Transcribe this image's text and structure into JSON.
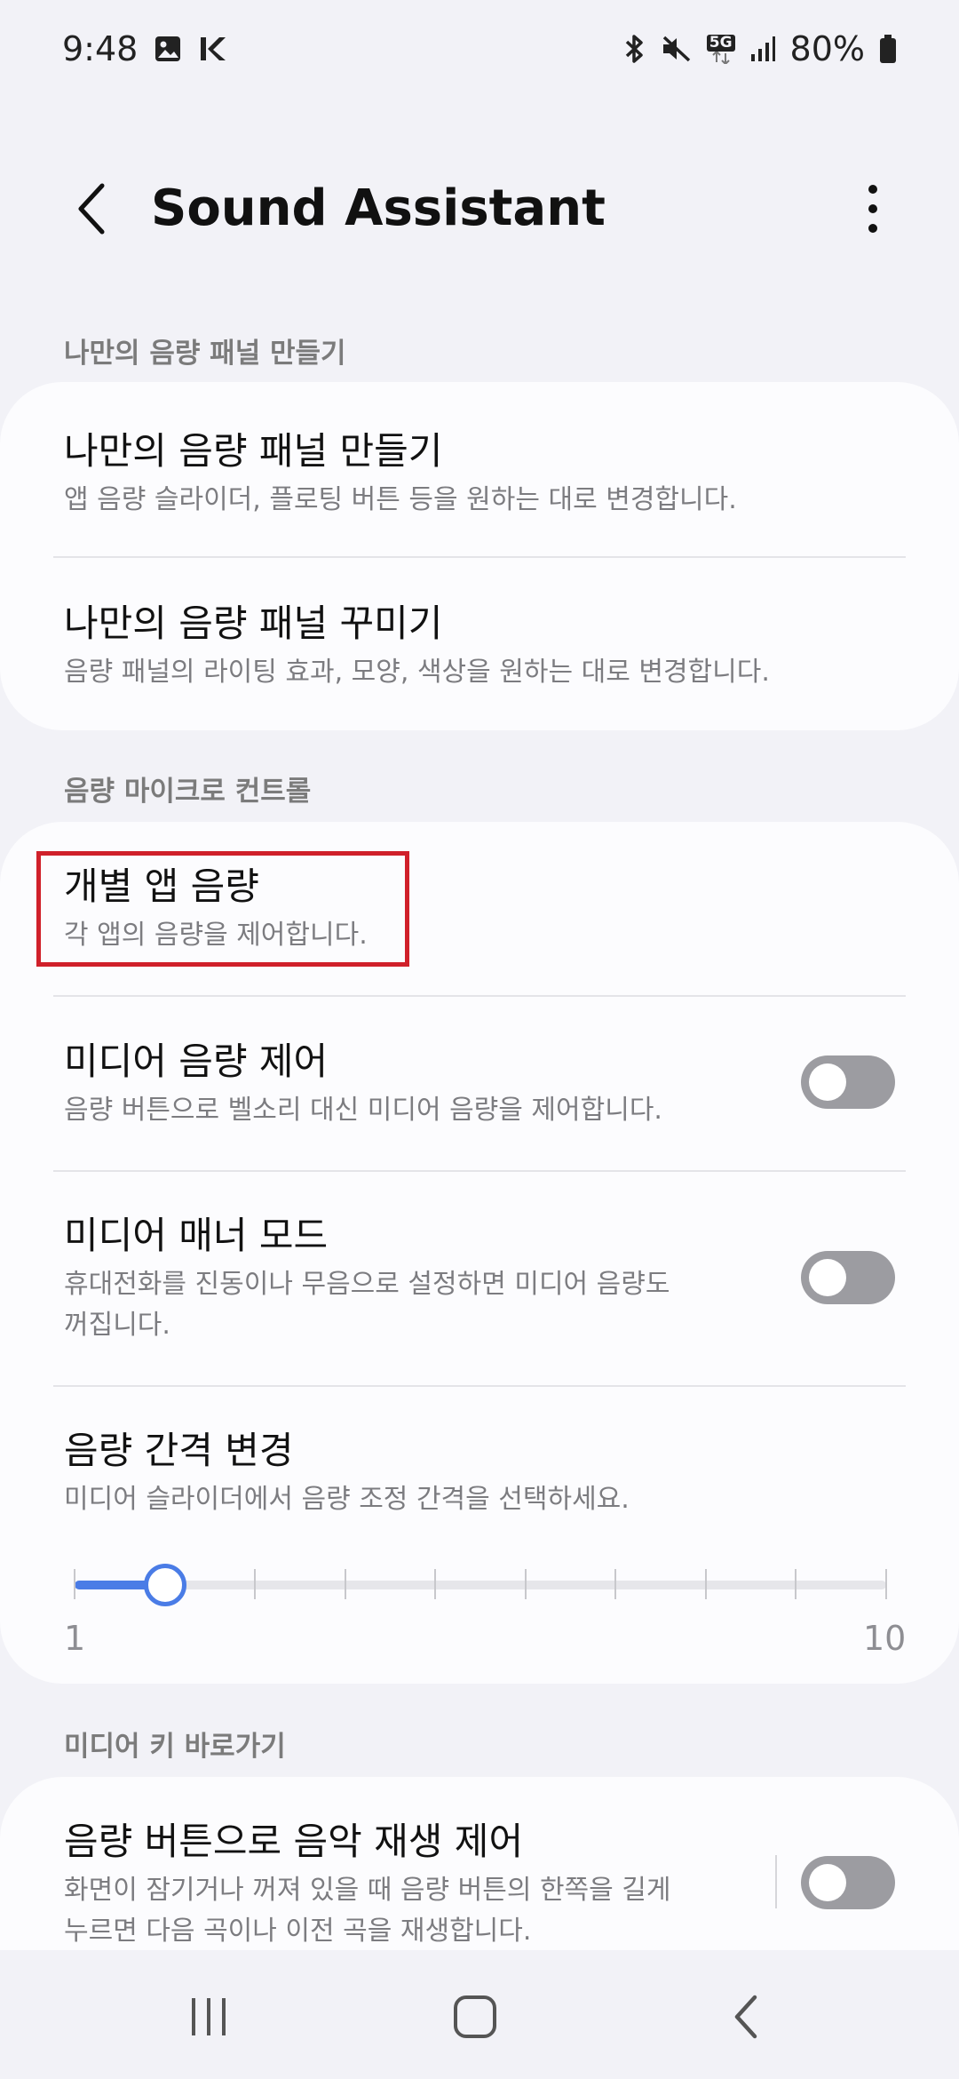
{
  "status": {
    "time": "9:48",
    "battery": "80%",
    "network": "5G",
    "icons_left": [
      "image-icon",
      "k-app-icon"
    ],
    "icons_right": [
      "bluetooth-icon",
      "mute-icon",
      "5g-icon",
      "signal-icon",
      "battery-icon"
    ]
  },
  "header": {
    "title": "Sound Assistant",
    "back_icon": "chevron-left-icon",
    "more_icon": "more-vertical-icon"
  },
  "sections": [
    {
      "label": "나만의 음량 패널 만들기",
      "items": [
        {
          "title": "나만의 음량 패널 만들기",
          "subtitle": "앱 음량 슬라이더, 플로팅 버튼 등을 원하는 대로 변경합니다."
        },
        {
          "title": "나만의 음량 패널 꾸미기",
          "subtitle": "음량 패널의 라이팅 효과, 모양, 색상을 원하는 대로 변경합니다."
        }
      ]
    },
    {
      "label": "음량 마이크로 컨트롤",
      "items": [
        {
          "title": "개별 앱 음량",
          "subtitle": "각 앱의 음량을 제어합니다."
        },
        {
          "title": "미디어 음량 제어",
          "subtitle": "음량 버튼으로 벨소리 대신 미디어 음량을 제어합니다.",
          "toggle": false
        },
        {
          "title": "미디어 매너 모드",
          "subtitle_line1": "휴대전화를 진동이나 무음으로 설정하면 미디어 음량도",
          "subtitle_line2": "꺼집니다.",
          "toggle": false
        },
        {
          "title": "음량 간격 변경",
          "subtitle": "미디어 슬라이더에서 음량 조정 간격을 선택하세요.",
          "slider": {
            "min": "1",
            "max": "10",
            "value": 2,
            "steps": 10
          }
        }
      ]
    },
    {
      "label": "미디어 키 바로가기",
      "items": [
        {
          "title": "음량 버튼으로 음악 재생 제어",
          "subtitle_line1": "화면이 잠기거나 꺼져 있을 때 음량 버튼의 한쪽을 길게",
          "subtitle_line2": "누르면 다음 곡이나 이전 곡을 재생합니다.",
          "toggle": false
        }
      ]
    }
  ],
  "colors": {
    "background": "#f2f2f7",
    "card": "#fcfcfe",
    "accent": "#4a7ce6",
    "highlight": "#d0202a",
    "toggle_off": "#9c9ca1"
  },
  "nav": {
    "recents_icon": "recents-icon",
    "home_icon": "home-icon",
    "back_icon": "back-icon"
  }
}
